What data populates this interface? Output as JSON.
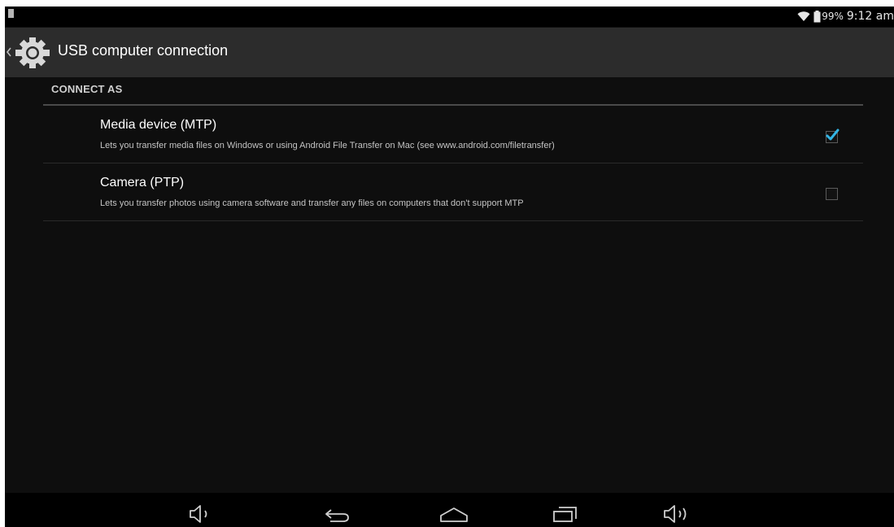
{
  "status_bar": {
    "battery": "99%",
    "time": "9:12 am",
    "icons": [
      "notification-icon",
      "wifi-icon",
      "battery-icon"
    ]
  },
  "action_bar": {
    "title": "USB computer connection",
    "icons": [
      "back-caret-icon",
      "settings-gear-icon"
    ]
  },
  "section": {
    "header": "CONNECT AS",
    "items": [
      {
        "title": "Media device (MTP)",
        "summary": "Lets you transfer media files on Windows or using Android File Transfer on Mac (see www.android.com/filetransfer)",
        "checked": true
      },
      {
        "title": "Camera (PTP)",
        "summary": "Lets you transfer photos using camera software and transfer any files on computers that don't support MTP",
        "checked": false
      }
    ]
  },
  "nav_bar": {
    "buttons": [
      "volume-down-icon",
      "back-icon",
      "home-icon",
      "recents-icon",
      "volume-up-icon"
    ]
  },
  "colors": {
    "background": "#0e0e0e",
    "action_bar": "#2c2c2c",
    "accent_check": "#33b5e5",
    "text_primary": "#ffffff",
    "text_secondary": "#c4c4c4"
  }
}
